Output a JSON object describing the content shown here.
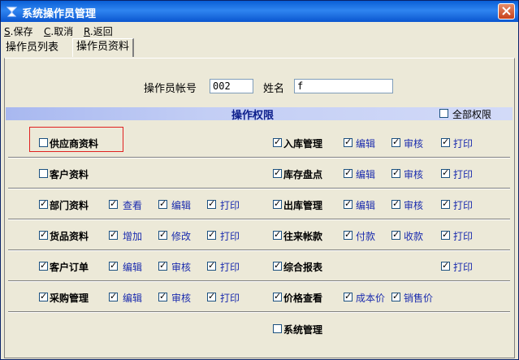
{
  "window": {
    "title": "系统操作员管理"
  },
  "menu": [
    {
      "key": "S",
      "label": ".保存"
    },
    {
      "key": "C",
      "label": ".取消"
    },
    {
      "key": "R",
      "label": ".返回"
    }
  ],
  "tabs": {
    "list": "操作员列表",
    "info": "操作员资料"
  },
  "form": {
    "account_label": "操作员帐号",
    "account_value": "002",
    "name_label": "姓名",
    "name_value": "f"
  },
  "permissions": {
    "title": "操作权限",
    "all_label": "全部权限",
    "all_checked": false
  },
  "rows": {
    "r1": {
      "a": {
        "label": "供应商资料",
        "checked": false
      },
      "b": {
        "label": "入库管理",
        "checked": true
      },
      "b1": {
        "label": "编辑",
        "checked": true
      },
      "b2": {
        "label": "审核",
        "checked": true
      },
      "b3": {
        "label": "打印",
        "checked": true
      }
    },
    "r2": {
      "a": {
        "label": "客户资料",
        "checked": false
      },
      "b": {
        "label": "库存盘点",
        "checked": true
      },
      "b1": {
        "label": "编辑",
        "checked": true
      },
      "b2": {
        "label": "审核",
        "checked": true
      },
      "b3": {
        "label": "打印",
        "checked": true
      }
    },
    "r3": {
      "a": {
        "label": "部门资料",
        "checked": true
      },
      "a1": {
        "label": "查看",
        "checked": true
      },
      "a2": {
        "label": "编辑",
        "checked": true
      },
      "a3": {
        "label": "打印",
        "checked": true
      },
      "b": {
        "label": "出库管理",
        "checked": true
      },
      "b1": {
        "label": "编辑",
        "checked": true
      },
      "b2": {
        "label": "审核",
        "checked": true
      },
      "b3": {
        "label": "打印",
        "checked": true
      }
    },
    "r4": {
      "a": {
        "label": "货品资料",
        "checked": true
      },
      "a1": {
        "label": "增加",
        "checked": true
      },
      "a2": {
        "label": "修改",
        "checked": true
      },
      "a3": {
        "label": "打印",
        "checked": true
      },
      "b": {
        "label": "往来帐款",
        "checked": true
      },
      "b1": {
        "label": "付款",
        "checked": true
      },
      "b2": {
        "label": "收款",
        "checked": true
      },
      "b3": {
        "label": "打印",
        "checked": true
      }
    },
    "r5": {
      "a": {
        "label": "客户订单",
        "checked": true
      },
      "a1": {
        "label": "编辑",
        "checked": true
      },
      "a2": {
        "label": "审核",
        "checked": true
      },
      "a3": {
        "label": "打印",
        "checked": true
      },
      "b": {
        "label": "综合报表",
        "checked": true
      },
      "b3": {
        "label": "打印",
        "checked": true
      }
    },
    "r6": {
      "a": {
        "label": "采购管理",
        "checked": true
      },
      "a1": {
        "label": "编辑",
        "checked": true
      },
      "a2": {
        "label": "审核",
        "checked": true
      },
      "a3": {
        "label": "打印",
        "checked": true
      },
      "b": {
        "label": "价格查看",
        "checked": true
      },
      "b1": {
        "label": "成本价",
        "checked": true
      },
      "b2": {
        "label": "销售价",
        "checked": true
      }
    },
    "r7": {
      "b": {
        "label": "系统管理",
        "checked": false
      }
    }
  }
}
